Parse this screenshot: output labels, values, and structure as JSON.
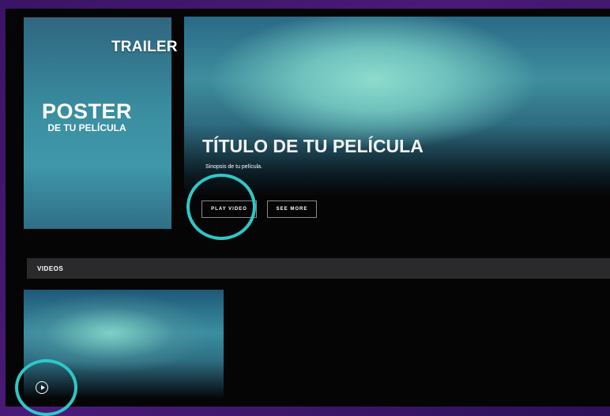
{
  "poster": {
    "title": "POSTER",
    "subtitle": "DE TU PELÍCULA"
  },
  "trailer_label": "TRAILER",
  "hero": {
    "title": "TÍTULO DE TU PELÍCULA",
    "synopsis": "Sinopsis de tu película.",
    "play_label": "PLAY VIDEO",
    "more_label": "SEE MORE"
  },
  "videos": {
    "section_label": "VIDEOS",
    "items": [
      {
        "icon": "play-circle-icon"
      }
    ]
  },
  "colors": {
    "highlight_ring": "#2ec8c8",
    "frame": "#050506",
    "section_bar": "#2a2a2c"
  }
}
